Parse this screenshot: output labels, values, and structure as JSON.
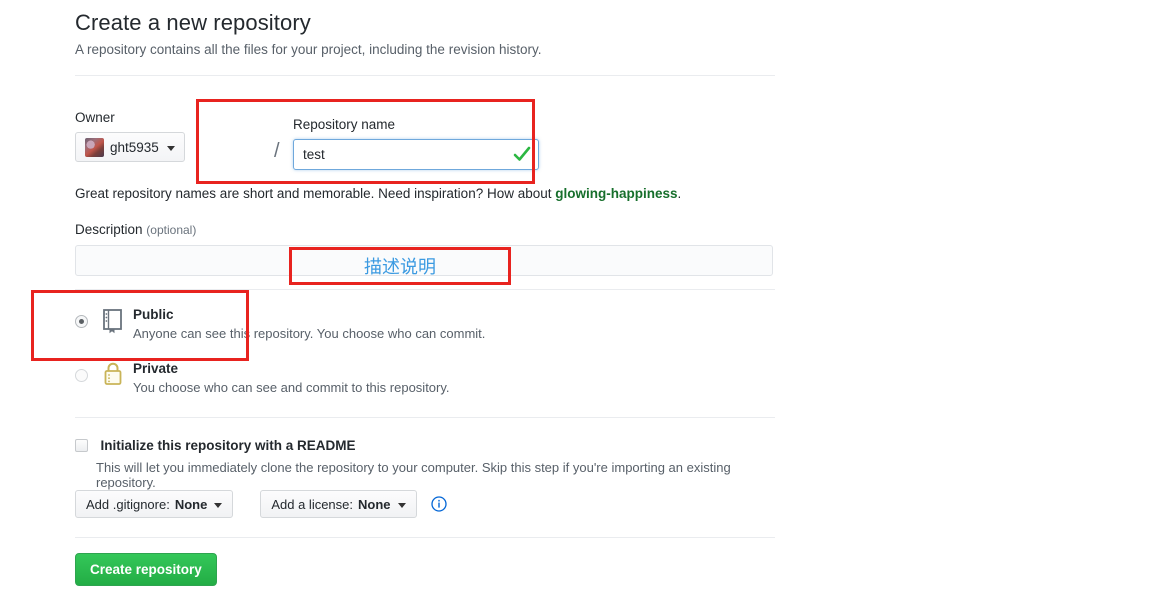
{
  "header": {
    "title": "Create a new repository",
    "subtitle": "A repository contains all the files for your project, including the revision history."
  },
  "owner": {
    "label": "Owner",
    "name": "ght5935",
    "avatar_icon": "user-avatar",
    "caret_icon": "caret-down-icon",
    "separator": "/"
  },
  "repo_name": {
    "label": "Repository name",
    "value": "test",
    "placeholder": "",
    "valid_icon": "check-icon",
    "valid_color": "#28a745"
  },
  "hint": {
    "text_before": "Great repository names are short and memorable. Need inspiration? How about ",
    "suggestion": "glowing-happiness",
    "text_after": ".",
    "suggestion_color": "#176f2c"
  },
  "description": {
    "label": "Description",
    "optional": "(optional)",
    "value": "",
    "placeholder": ""
  },
  "visibility": {
    "options": [
      {
        "name": "Public",
        "description": "Anyone can see this repository. You choose who can commit.",
        "selected": true,
        "icon": "repo-book-icon",
        "icon_color": "#6a737d"
      },
      {
        "name": "Private",
        "description": "You choose who can see and commit to this repository.",
        "selected": false,
        "icon": "lock-icon",
        "icon_color": "#c9b458"
      }
    ]
  },
  "readme": {
    "checked": false,
    "label": "Initialize this repository with a README",
    "description": "This will let you immediately clone the repository to your computer. Skip this step if you're importing an existing repository."
  },
  "selects": {
    "gitignore": {
      "prefix": "Add .gitignore: ",
      "value": "None",
      "caret_icon": "caret-down-icon"
    },
    "license": {
      "prefix": "Add a license: ",
      "value": "None",
      "caret_icon": "caret-down-icon"
    },
    "info_icon": "info-circle-icon",
    "info_icon_color": "#0366d6"
  },
  "submit": {
    "label": "Create repository",
    "color": "#2ea44f"
  },
  "annotations": {
    "box_color": "#e8231f",
    "repo_name_box": "repository-name-highlight",
    "description_box": "description-highlight",
    "public_box": "public-visibility-highlight",
    "description_note": "描述说明",
    "description_note_color": "#3b9ae1"
  }
}
